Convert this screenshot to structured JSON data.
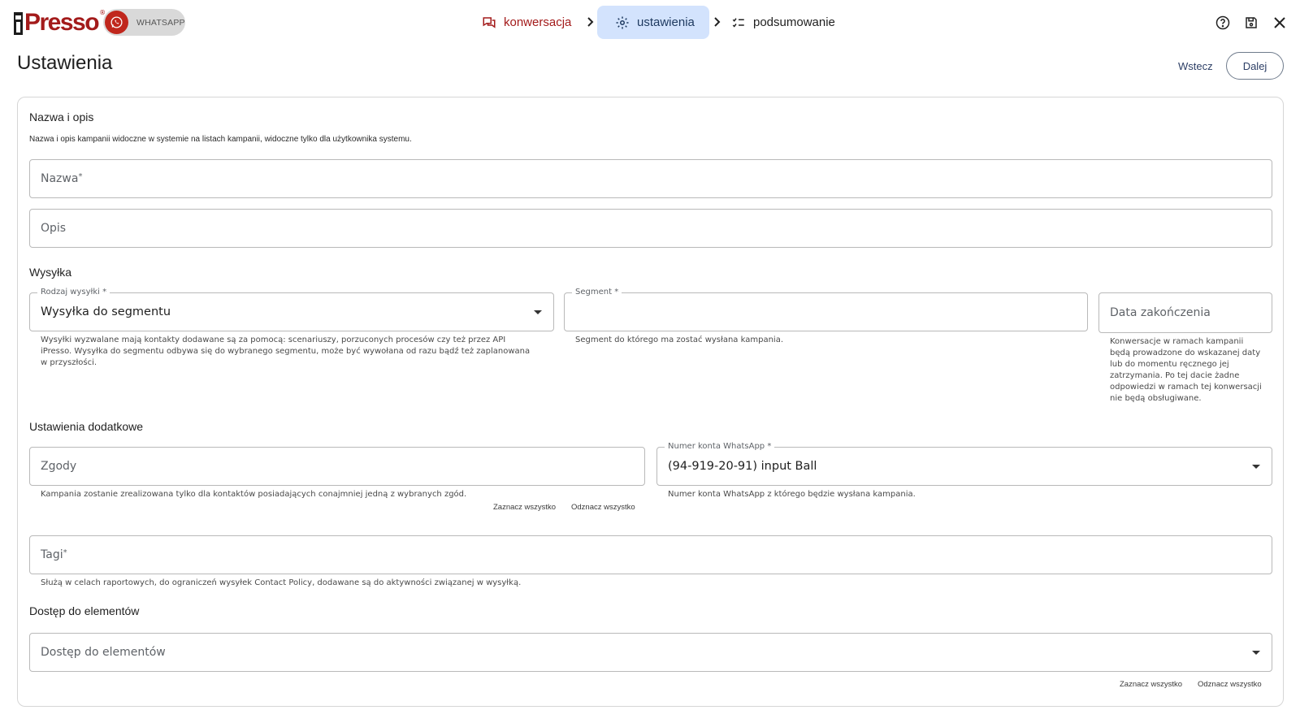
{
  "brand": {
    "logo_text": "Presso",
    "logo_reg": "®",
    "channel": "WHATSAPP",
    "accent": "#a31b1b"
  },
  "stepper": {
    "steps": [
      {
        "label": "konwersacja",
        "icon": "chat-icon"
      },
      {
        "label": "ustawienia",
        "icon": "gear-icon",
        "active": true
      },
      {
        "label": "podsumowanie",
        "icon": "checklist-icon"
      }
    ]
  },
  "toolbar": {
    "help_icon": "help-icon",
    "save_icon": "save-icon",
    "close_icon": "close-icon"
  },
  "page": {
    "title": "Ustawienia",
    "back_label": "Wstecz",
    "next_label": "Dalej"
  },
  "name_section": {
    "title": "Nazwa i opis",
    "description": "Nazwa i opis kampanii widoczne w systemie na listach kampanii, widoczne tylko dla użytkownika systemu.",
    "name_placeholder": "Nazwa",
    "desc_placeholder": "Opis"
  },
  "send_section": {
    "title": "Wysyłka",
    "type_label": "Rodzaj wysyłki",
    "type_value": "Wysyłka do segmentu",
    "type_hint": "Wysyłki wyzwalane mają kontakty dodawane są za pomocą: scenariuszy, porzuconych procesów czy też przez API iPresso. Wysyłka do segmentu odbywa się do wybranego segmentu, może być wywołana od razu bądź też zaplanowana w przyszłości.",
    "segment_label": "Segment",
    "segment_hint": "Segment do którego ma zostać wysłana kampania.",
    "end_date_placeholder": "Data zakończenia",
    "end_date_hint": "Konwersacje w ramach kampanii będą prowadzone do wskazanej daty lub do momentu ręcznego jej zatrzymania. Po tej dacie żadne odpowiedzi w ramach tej konwersacji nie będą obsługiwane."
  },
  "extra_section": {
    "title": "Ustawienia dodatkowe",
    "consents_placeholder": "Zgody",
    "consents_hint": "Kampania zostanie zrealizowana tylko dla kontaktów posiadających conajmniej jedną z wybranych zgód.",
    "select_all": "Zaznacz wszystko",
    "deselect_all": "Odznacz wszystko",
    "account_label": "Numer konta WhatsApp",
    "account_value": "(94-919-20-91) input Ball",
    "account_hint": "Numer konta WhatsApp z którego będzie wysłana kampania.",
    "tags_placeholder": "Tagi",
    "tags_hint": "Służą w celach raportowych, do ograniczeń wysyłek Contact Policy, dodawane są do aktywności związanej w wysyłką."
  },
  "access_section": {
    "title": "Dostęp do elementów",
    "placeholder": "Dostęp do elementów",
    "select_all": "Zaznacz wszystko",
    "deselect_all": "Odznacz wszystko"
  },
  "required_mark": "*"
}
